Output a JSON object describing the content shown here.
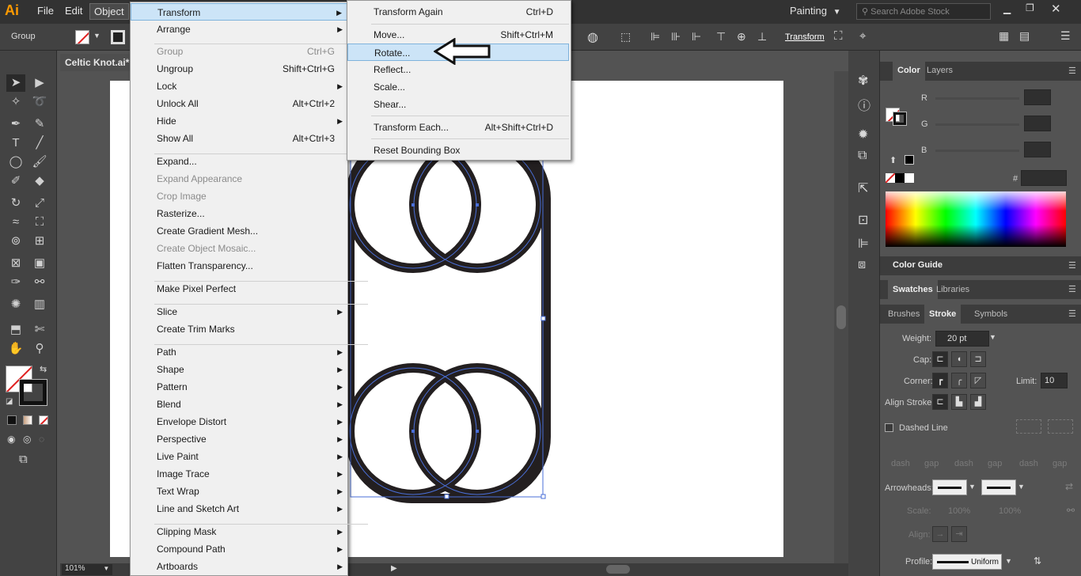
{
  "app": {
    "logo": "Ai"
  },
  "menubar": {
    "items": [
      "File",
      "Edit",
      "Object"
    ],
    "workspace": "Painting",
    "search_placeholder": "Search Adobe Stock"
  },
  "control_bar": {
    "selection_label": "Group",
    "transform_label": "Transform"
  },
  "document": {
    "tab_title": "Celtic Knot.ai*",
    "zoom": "101%"
  },
  "object_menu": {
    "items": [
      {
        "label": "Transform",
        "shortcut": "",
        "submenu": true,
        "disabled": false,
        "highlight": true
      },
      {
        "label": "Arrange",
        "shortcut": "",
        "submenu": true,
        "disabled": false
      },
      {
        "label": "Group",
        "shortcut": "Ctrl+G",
        "submenu": false,
        "disabled": true
      },
      {
        "label": "Ungroup",
        "shortcut": "Shift+Ctrl+G",
        "submenu": false,
        "disabled": false
      },
      {
        "label": "Lock",
        "shortcut": "",
        "submenu": true,
        "disabled": false
      },
      {
        "label": "Unlock All",
        "shortcut": "Alt+Ctrl+2",
        "submenu": false,
        "disabled": false
      },
      {
        "label": "Hide",
        "shortcut": "",
        "submenu": true,
        "disabled": false
      },
      {
        "label": "Show All",
        "shortcut": "Alt+Ctrl+3",
        "submenu": false,
        "disabled": false
      },
      {
        "label": "Expand...",
        "shortcut": "",
        "submenu": false,
        "disabled": false
      },
      {
        "label": "Expand Appearance",
        "shortcut": "",
        "submenu": false,
        "disabled": true
      },
      {
        "label": "Crop Image",
        "shortcut": "",
        "submenu": false,
        "disabled": true
      },
      {
        "label": "Rasterize...",
        "shortcut": "",
        "submenu": false,
        "disabled": false
      },
      {
        "label": "Create Gradient Mesh...",
        "shortcut": "",
        "submenu": false,
        "disabled": false
      },
      {
        "label": "Create Object Mosaic...",
        "shortcut": "",
        "submenu": false,
        "disabled": true
      },
      {
        "label": "Flatten Transparency...",
        "shortcut": "",
        "submenu": false,
        "disabled": false
      },
      {
        "label": "Make Pixel Perfect",
        "shortcut": "",
        "submenu": false,
        "disabled": false
      },
      {
        "label": "Slice",
        "shortcut": "",
        "submenu": true,
        "disabled": false
      },
      {
        "label": "Create Trim Marks",
        "shortcut": "",
        "submenu": false,
        "disabled": false
      },
      {
        "label": "Path",
        "shortcut": "",
        "submenu": true,
        "disabled": false
      },
      {
        "label": "Shape",
        "shortcut": "",
        "submenu": true,
        "disabled": false
      },
      {
        "label": "Pattern",
        "shortcut": "",
        "submenu": true,
        "disabled": false
      },
      {
        "label": "Blend",
        "shortcut": "",
        "submenu": true,
        "disabled": false
      },
      {
        "label": "Envelope Distort",
        "shortcut": "",
        "submenu": true,
        "disabled": false
      },
      {
        "label": "Perspective",
        "shortcut": "",
        "submenu": true,
        "disabled": false
      },
      {
        "label": "Live Paint",
        "shortcut": "",
        "submenu": true,
        "disabled": false
      },
      {
        "label": "Image Trace",
        "shortcut": "",
        "submenu": true,
        "disabled": false
      },
      {
        "label": "Text Wrap",
        "shortcut": "",
        "submenu": true,
        "disabled": false
      },
      {
        "label": "Line and Sketch Art",
        "shortcut": "",
        "submenu": true,
        "disabled": false
      },
      {
        "label": "Clipping Mask",
        "shortcut": "",
        "submenu": true,
        "disabled": false
      },
      {
        "label": "Compound Path",
        "shortcut": "",
        "submenu": true,
        "disabled": false
      },
      {
        "label": "Artboards",
        "shortcut": "",
        "submenu": true,
        "disabled": false
      }
    ]
  },
  "transform_menu": {
    "items": [
      {
        "label": "Transform Again",
        "shortcut": "Ctrl+D"
      },
      {
        "label": "Move...",
        "shortcut": "Shift+Ctrl+M"
      },
      {
        "label": "Rotate...",
        "shortcut": ""
      },
      {
        "label": "Reflect...",
        "shortcut": ""
      },
      {
        "label": "Scale...",
        "shortcut": ""
      },
      {
        "label": "Shear...",
        "shortcut": ""
      },
      {
        "label": "Transform Each...",
        "shortcut": "Alt+Shift+Ctrl+D"
      },
      {
        "label": "Reset Bounding Box",
        "shortcut": ""
      }
    ],
    "highlighted": "Rotate..."
  },
  "color_panel": {
    "tabs": [
      "Color",
      "Layers"
    ],
    "channels": [
      "R",
      "G",
      "B"
    ],
    "hex_label": "#",
    "guide_title": "Color Guide"
  },
  "swatches_panel": {
    "tabs": [
      "Swatches",
      "Libraries"
    ]
  },
  "stroke_panel": {
    "tabs": [
      "Brushes",
      "Stroke",
      "Symbols"
    ],
    "weight_label": "Weight:",
    "weight_value": "20 pt",
    "cap_label": "Cap:",
    "corner_label": "Corner:",
    "limit_label": "Limit:",
    "limit_value": "10",
    "align_label": "Align Stroke:",
    "dashed_label": "Dashed Line",
    "dash_labels": [
      "dash",
      "gap",
      "dash",
      "gap",
      "dash",
      "gap"
    ],
    "arrowheads_label": "Arrowheads:",
    "scale_label": "Scale:",
    "scale_values": [
      "100%",
      "100%"
    ],
    "align_label2": "Align:",
    "profile_label": "Profile:",
    "profile_value": "Uniform"
  },
  "colors": {
    "selection": "#4a6fd8",
    "menu_highlight": "#cce4f7",
    "stroke": "#231f20"
  }
}
